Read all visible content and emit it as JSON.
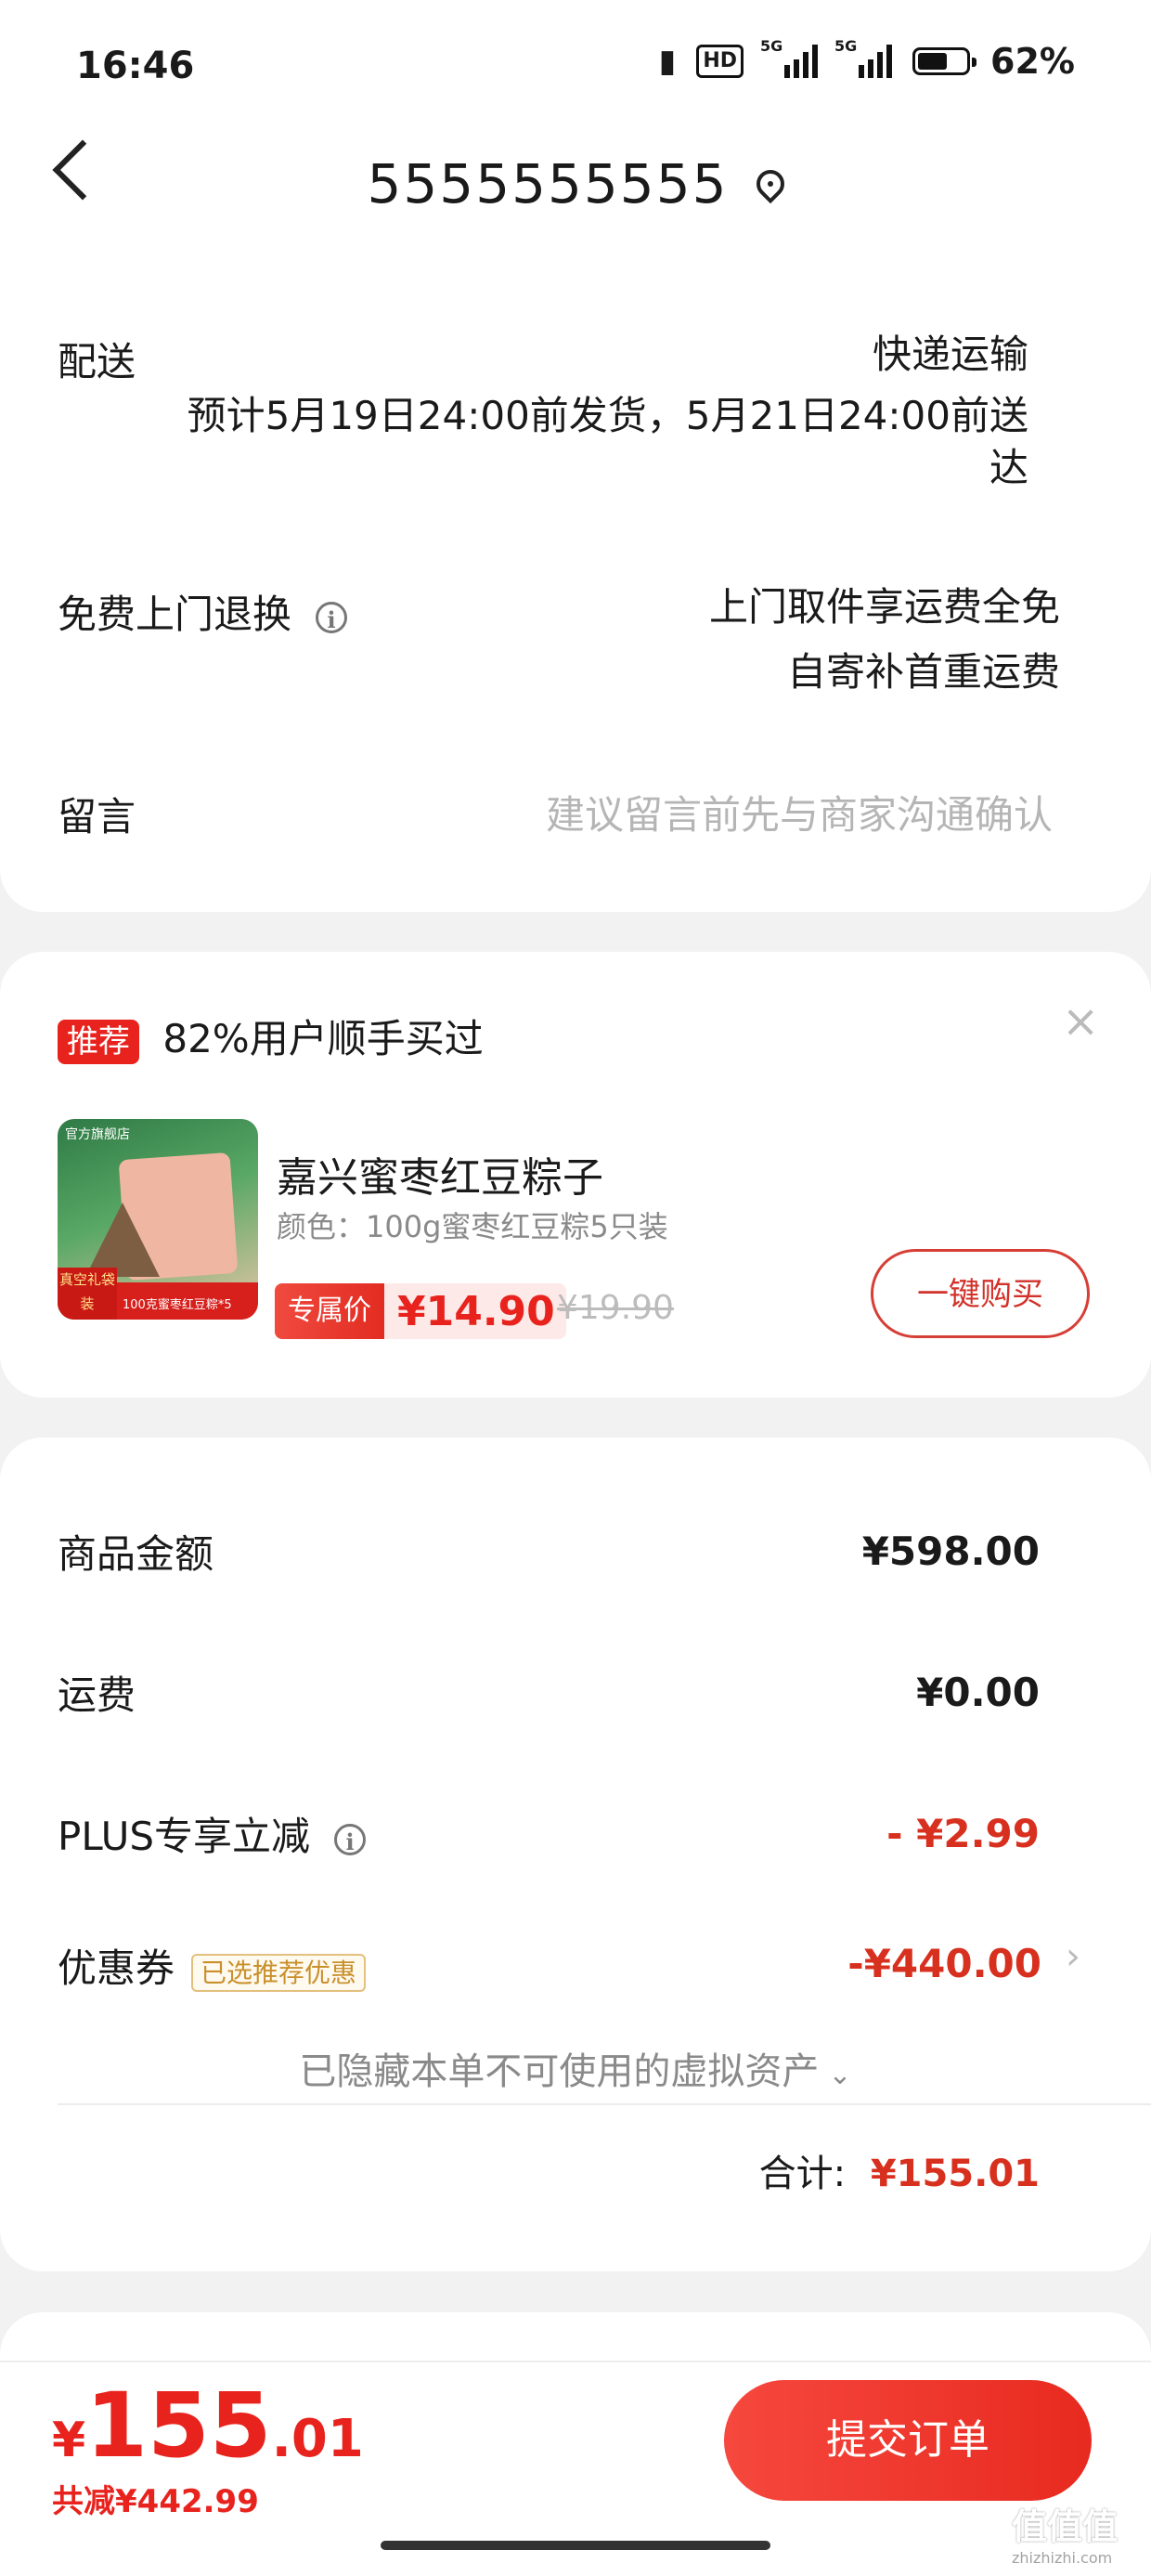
{
  "status_bar": {
    "time": "16:46",
    "hd": "HD",
    "net1": "5G",
    "net2": "5G",
    "battery_level": 0.62,
    "battery": "62%"
  },
  "header": {
    "title": "5555555555",
    "icon": "location-icon"
  },
  "delivery": {
    "label": "配送",
    "method": "快递运输",
    "estimate_line1": "预计5月19日24:00前发货，5月21日24:00前送",
    "estimate_line2": "达"
  },
  "returns": {
    "label": "免费上门退换",
    "info_icon": "i",
    "line1": "上门取件享运费全免",
    "line2": "自寄补首重运费"
  },
  "message": {
    "label": "留言",
    "placeholder": "建议留言前先与商家沟通确认"
  },
  "recommend": {
    "tag": "推荐",
    "text": "82%用户顺手买过",
    "close": "×",
    "product": {
      "name": "嘉兴蜜枣红豆粽子",
      "spec": "颜色：100g蜜枣红豆粽5只装",
      "exclusive_label": "专属价",
      "price": "¥14.90",
      "original_price": "¥19.90",
      "buy_button": "一键购买",
      "thumb_shop": "官方旗舰店",
      "thumb_tag": "真空礼袋装",
      "thumb_caption": "100克蜜枣红豆粽*5"
    }
  },
  "summary": {
    "goods_label": "商品金额",
    "goods_amount": "¥598.00",
    "shipping_label": "运费",
    "shipping_amount": "¥0.00",
    "plus_label": "PLUS专享立减",
    "plus_amount": "- ¥2.99",
    "coupon_label": "优惠券",
    "coupon_tag": "已选推荐优惠",
    "coupon_amount": "-¥440.00",
    "hidden_assets": "已隐藏本单不可使用的虚拟资产",
    "total_label": "合计:",
    "total_amount": "¥155.01"
  },
  "bottom_bar": {
    "currency": "¥",
    "total_int": "155",
    "total_dec": ".01",
    "saved": "共减¥442.99",
    "submit": "提交订单"
  },
  "watermark": {
    "mark": "值值值",
    "site": "zhizhizhi.com"
  }
}
